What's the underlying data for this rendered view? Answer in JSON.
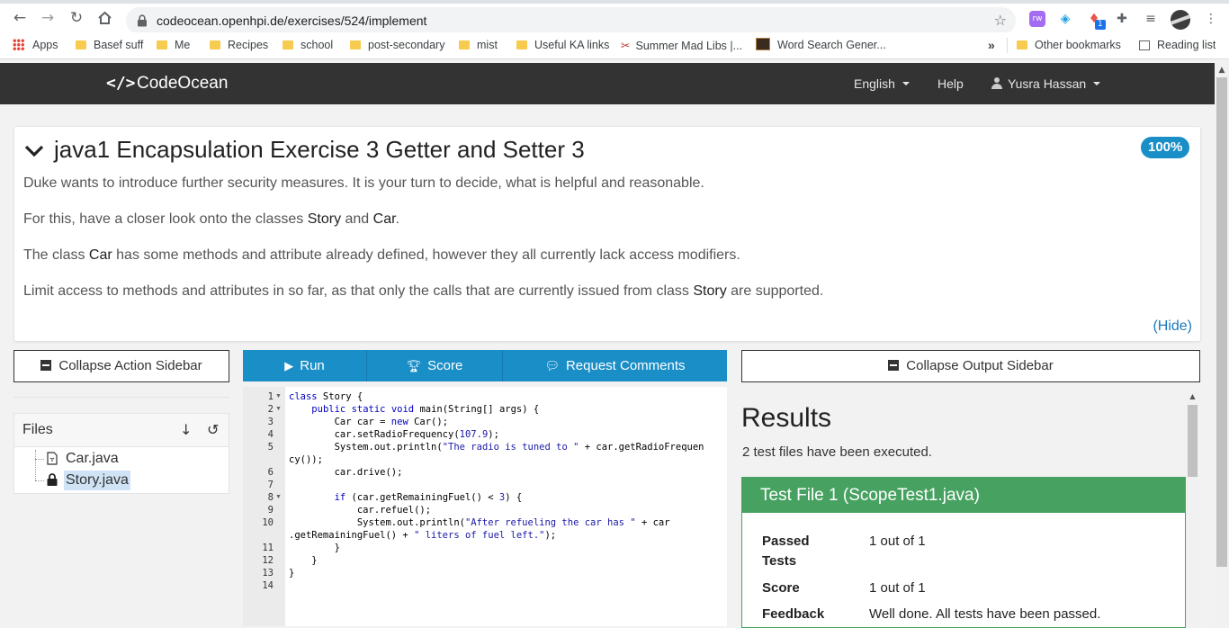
{
  "browser": {
    "url": "codeocean.openhpi.de/exercises/524/implement",
    "bookmarks": [
      {
        "label": "Apps",
        "icon": "apps-grid-icon"
      },
      {
        "label": "Basef suff",
        "icon": "folder-icon"
      },
      {
        "label": "Me",
        "icon": "folder-icon"
      },
      {
        "label": "Recipes",
        "icon": "folder-icon"
      },
      {
        "label": "school",
        "icon": "folder-icon"
      },
      {
        "label": "post-secondary",
        "icon": "folder-icon"
      },
      {
        "label": "mist",
        "icon": "folder-icon"
      },
      {
        "label": "Useful KA links",
        "icon": "folder-icon"
      },
      {
        "label": "Summer Mad Libs |...",
        "icon": "madlibs-icon"
      },
      {
        "label": "Word Search Gener...",
        "icon": "wordsearch-icon"
      }
    ],
    "overflow_label": "»",
    "other_bookmarks": "Other bookmarks",
    "reading_list": "Reading list",
    "extension_badge": "1"
  },
  "header": {
    "logo_icon": "</>",
    "app_name": "CodeOcean",
    "language": "English",
    "help": "Help",
    "user": "Yusra Hassan"
  },
  "exercise": {
    "title": "java1 Encapsulation Exercise 3 Getter and Setter 3",
    "progress": "100%",
    "description": [
      {
        "parts": [
          "Duke wants to introduce further security measures. It is your turn to decide, what is helpful and reasonable."
        ]
      },
      {
        "parts": [
          "For this, have a closer look onto the classes ",
          "Story",
          " and ",
          "Car",
          "."
        ]
      },
      {
        "parts": [
          "The class ",
          "Car",
          " has some methods and attribute already defined, however they all currently lack access modifiers."
        ]
      },
      {
        "parts": [
          "Limit access to methods and attributes in so far, as that only the calls that are currently issued from class ",
          "Story",
          " are supported."
        ]
      }
    ],
    "hide_label": "(Hide)"
  },
  "action_sidebar": {
    "collapse_label": "Collapse Action Sidebar",
    "files_title": "Files",
    "files": [
      {
        "name": "Car.java",
        "icon": "java-file-icon",
        "selected": false
      },
      {
        "name": "Story.java",
        "icon": "lock-icon",
        "selected": true
      }
    ]
  },
  "editor": {
    "run_label": "Run",
    "score_label": "Score",
    "comments_label": "Request Comments",
    "line_numbers": [
      "1",
      "2",
      "3",
      "4",
      "5",
      "",
      "6",
      "7",
      "8",
      "9",
      "10",
      "",
      "11",
      "12",
      "13",
      "14"
    ],
    "fold_rows": [
      0,
      1,
      8
    ],
    "code_lines": [
      "class Story {",
      "    public static void main(String[] args) {",
      "        Car car = new Car();",
      "        car.setRadioFrequency(107.9);",
      "        System.out.println(\"The radio is tuned to \" + car.getRadioFrequen",
      "cy());",
      "        car.drive();",
      "",
      "        if (car.getRemainingFuel() < 3) {",
      "            car.refuel();",
      "            System.out.println(\"After refueling the car has \" + car",
      ".getRemainingFuel() + \" liters of fuel left.\");",
      "        }",
      "    }",
      "}",
      ""
    ]
  },
  "output_sidebar": {
    "collapse_label": "Collapse Output Sidebar",
    "results_title": "Results",
    "results_summary": "2 test files have been executed.",
    "test_file": {
      "title": "Test File 1 (ScopeTest1.java)",
      "rows": [
        {
          "label": "Passed Tests",
          "value": "1 out of 1"
        },
        {
          "label": "Score",
          "value": "1 out of 1"
        },
        {
          "label": "Feedback",
          "value": "Well done. All tests have been passed."
        }
      ]
    }
  },
  "colors": {
    "accent": "#1a8ec7",
    "success": "#47a261",
    "header_bg": "#333333",
    "link": "#1a7bbd"
  }
}
